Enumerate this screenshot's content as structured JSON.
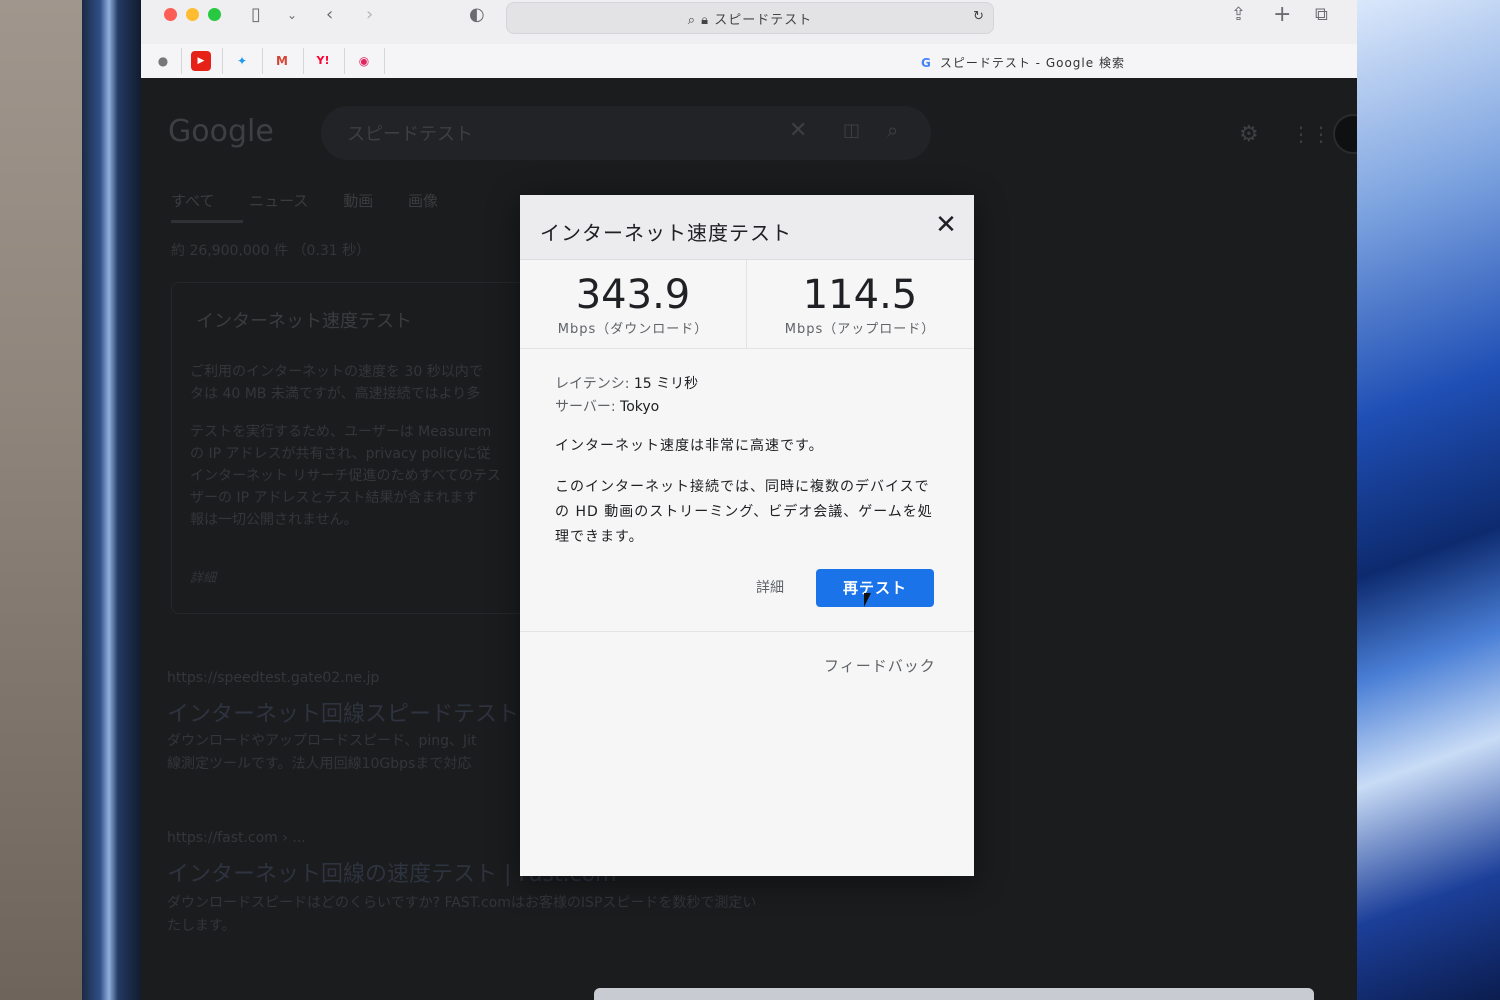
{
  "browser": {
    "address": "スピードテスト",
    "tab_title": "スピードテスト - Google 検索",
    "bookmarks": [
      "apple-icon",
      "youtube-icon",
      "twitter-icon",
      "gmail-icon",
      "yahoo-icon",
      "record-icon"
    ]
  },
  "page": {
    "logo": "Google",
    "search_query": "スピードテスト",
    "tabs": [
      "すべて",
      "ニュース",
      "動画",
      "画像"
    ],
    "result_count": "約 26,900,000 件 （0.31 秒）",
    "card": {
      "title": "インターネット速度テスト",
      "body1": "ご利用のインターネットの速度を 30 秒以内で",
      "body2": "タは 40 MB 未満ですが、高速接続ではより多",
      "body3": "テストを実行するため、ユーザーは Measurem",
      "body4": "の IP アドレスが共有され、privacy policyに従",
      "body5": "インターネット リサーチ促進のためすべてのテス",
      "body6": "ザーの IP アドレスとテスト結果が含まれます",
      "body7": "報は一切公開されません。",
      "detail": "詳細"
    },
    "results": [
      {
        "url": "https://speedtest.gate02.ne.jp",
        "title": "インターネット回線スピードテスト",
        "desc1": "ダウンロードやアップロードスピード、ping、Jit",
        "desc2": "線測定ツールです。法人用回線10Gbpsまで対応"
      },
      {
        "url": "https://fast.com › ...",
        "title": "インターネット回線の速度テスト | Fast.com",
        "desc1": "ダウンロードスピードはどのくらいですか? FAST.comはお客様のISPスピードを数秒で測定い",
        "desc2": "たします。"
      }
    ]
  },
  "dialog": {
    "title": "インターネット速度テスト",
    "download": {
      "value": "343.9",
      "unit": "Mbps（ダウンロード）"
    },
    "upload": {
      "value": "114.5",
      "unit": "Mbps（アップロード）"
    },
    "latency_label": "レイテンシ:",
    "latency_value": "15 ミリ秒",
    "server_label": "サーバー:",
    "server_value": "Tokyo",
    "speed_summary": "インターネット速度は非常に高速です。",
    "description": "このインターネット接続では、同時に複数のデバイスでの HD 動画のストリーミング、ビデオ会議、ゲームを処理できます。",
    "detail_link": "詳細",
    "retest_button": "再テスト",
    "feedback_link": "フィードバック"
  }
}
